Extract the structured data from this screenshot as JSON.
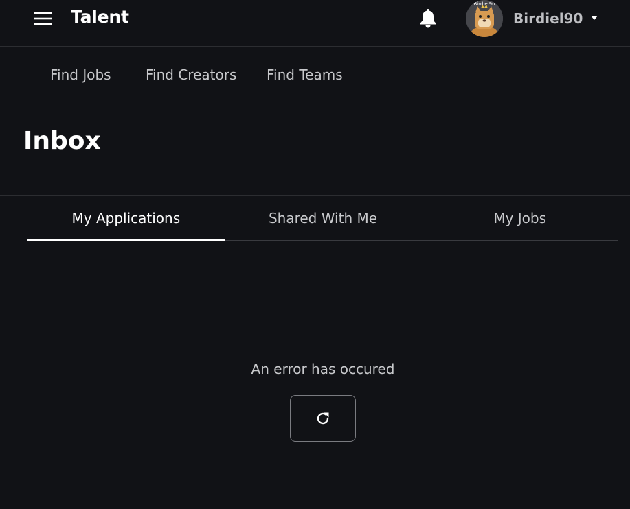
{
  "header": {
    "brand": "Talent",
    "menu_icon": "hamburger-menu-icon",
    "notification_icon": "bell-icon",
    "user": {
      "name": "Birdiel90",
      "avatar_label": "Birdiel90",
      "dropdown_icon": "caret-down-icon"
    }
  },
  "subnav": {
    "items": [
      {
        "label": "Find Jobs"
      },
      {
        "label": "Find Creators"
      },
      {
        "label": "Find Teams"
      }
    ]
  },
  "page": {
    "title": "Inbox"
  },
  "tabs": [
    {
      "label": "My Applications",
      "active": true
    },
    {
      "label": "Shared With Me",
      "active": false
    },
    {
      "label": "My Jobs",
      "active": false
    }
  ],
  "content": {
    "error_message": "An error has occured",
    "retry_icon": "refresh-icon"
  },
  "colors": {
    "background": "#111216",
    "divider": "#2c2d31",
    "text_primary": "#ffffff",
    "text_secondary": "#c8c9cc"
  }
}
